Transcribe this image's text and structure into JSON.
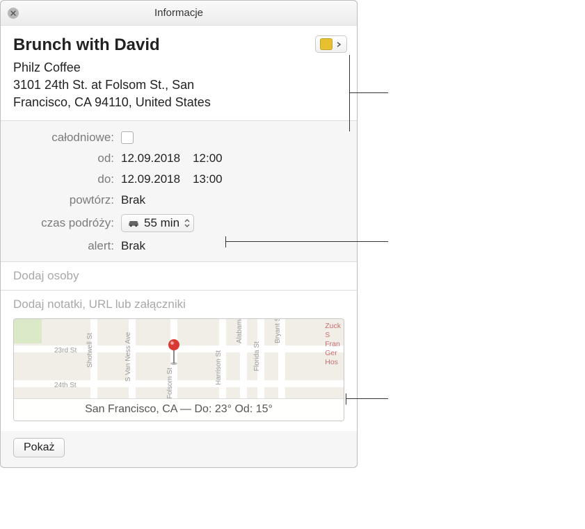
{
  "titlebar": {
    "title": "Informacje"
  },
  "header": {
    "event_title": "Brunch with David",
    "location_line1": "Philz Coffee",
    "location_line2": "3101 24th St. at Folsom St., San",
    "location_line3": "Francisco, CA 94110, United States"
  },
  "details": {
    "allday_label": "całodniowe:",
    "from_label": "od:",
    "from_date": "12.09.2018",
    "from_time": "12:00",
    "to_label": "do:",
    "to_date": "12.09.2018",
    "to_time": "13:00",
    "repeat_label": "powtórz:",
    "repeat_value": "Brak",
    "travel_label": "czas podróży:",
    "travel_value": "55 min",
    "alert_label": "alert:",
    "alert_value": "Brak"
  },
  "invitees": {
    "placeholder": "Dodaj osoby"
  },
  "notes": {
    "placeholder": "Dodaj notatki, URL lub załączniki"
  },
  "map": {
    "footer": "San Francisco, CA — Do: 23° Od: 15°",
    "streets_h": [
      "23rd St",
      "24th St"
    ],
    "streets_v": [
      "Shotwell St",
      "S Van Ness Ave",
      "Folsom St",
      "Harrison St",
      "Alabama St",
      "Florida St",
      "Bryant St"
    ],
    "hospital": "Zuck\nS\nFran\nGer\nHos"
  },
  "footer": {
    "show_button": "Pokaż"
  }
}
